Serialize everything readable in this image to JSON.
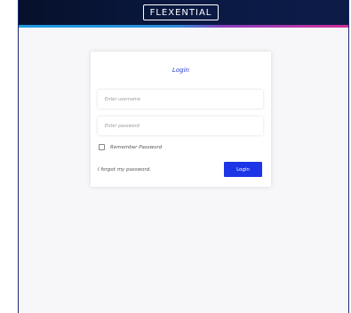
{
  "header": {
    "logo_text": "FLEXENTIAL"
  },
  "login": {
    "title": "Login",
    "username_placeholder": "Enter username",
    "password_placeholder": "Enter password",
    "remember_label": "Remember Password",
    "remember_checked": false,
    "forgot_label": "I forgot my password.",
    "submit_label": "Login"
  },
  "colors": {
    "header_bg": "#0b1a44",
    "accent_blue": "#1c35e6",
    "title_blue": "#2a3fcf",
    "stripe_left": "#1b9be0",
    "stripe_right": "#d22f9a"
  }
}
